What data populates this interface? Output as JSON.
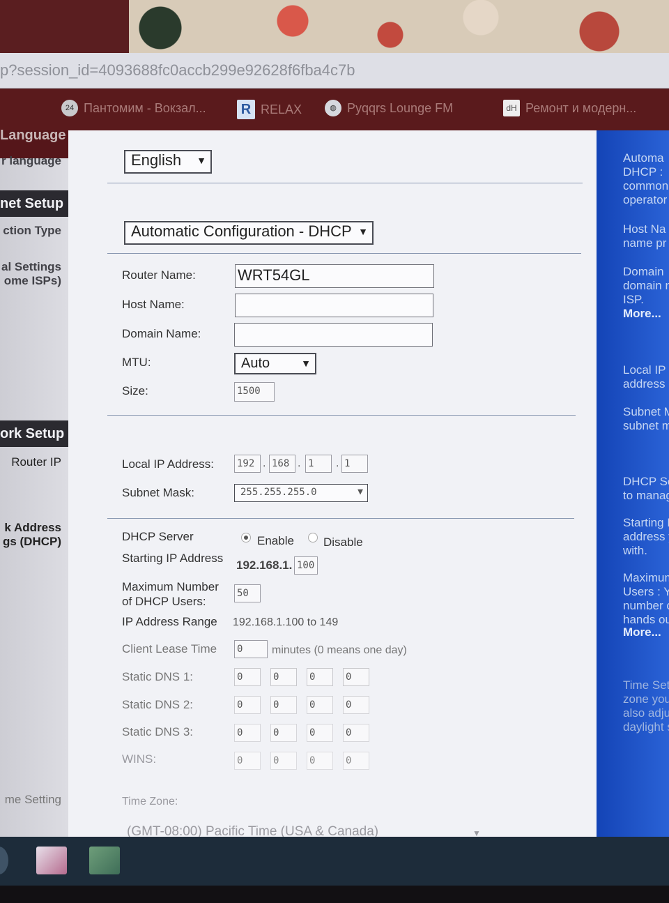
{
  "browser": {
    "url_fragment": "p?session_id=4093688fc0accb299e92628f6fba4c7b",
    "bookmarks": [
      {
        "icon": "badge-24-icon",
        "badge": "24",
        "label": "Пантомим - Вокзал..."
      },
      {
        "icon": "r-icon",
        "badge": "R",
        "label": "RELAX"
      },
      {
        "icon": "globe-icon",
        "badge": "",
        "label": "Pyqqrs Lounge FM"
      },
      {
        "icon": "dh-icon",
        "badge": "dH",
        "label": "Ремонт и модерн..."
      }
    ]
  },
  "leftnav": {
    "language_head": "Language",
    "language_item": "r language",
    "internet_head": "net Setup",
    "connection_type": "ction Type",
    "optional_settings": [
      "al Settings",
      "ome ISPs)"
    ],
    "network_head": "ork Setup",
    "router_ip": "Router IP",
    "address_settings": [
      "k Address",
      "gs (DHCP)"
    ],
    "time_setting": "me Setting"
  },
  "main": {
    "language_value": "English",
    "connection_value": "Automatic Configuration - DHCP",
    "router_name_label": "Router Name:",
    "router_name_value": "WRT54GL",
    "host_name_label": "Host Name:",
    "host_name_value": "",
    "domain_name_label": "Domain Name:",
    "domain_name_value": "",
    "mtu_label": "MTU:",
    "mtu_value": "Auto",
    "size_label": "Size:",
    "size_value": "1500",
    "local_ip_label": "Local IP Address:",
    "local_ip": [
      "192",
      "168",
      "1",
      "1"
    ],
    "subnet_label": "Subnet Mask:",
    "subnet_value": "255.255.255.0",
    "dhcp_server_label": "DHCP Server",
    "enable_label": "Enable",
    "disable_label": "Disable",
    "starting_ip_label": "Starting IP Address",
    "starting_ip_prefix": "192.168.1.",
    "starting_ip_last": "100",
    "max_users_label": "Maximum Number of  DHCP Users:",
    "max_users_value": "50",
    "ip_range_label": "IP Address Range",
    "ip_range_value": "192.168.1.100 to 149",
    "lease_label": "Client Lease Time",
    "lease_value": "0",
    "lease_suffix": "minutes (0 means one day)",
    "dns1_label": "Static DNS 1:",
    "dns2_label": "Static DNS 2:",
    "dns3_label": "Static DNS 3:",
    "wins_label": "WINS:",
    "dns_values": [
      "0",
      "0",
      "0",
      "0"
    ],
    "time_zone_label": "Time Zone:",
    "time_zone_value": "(GMT-08:00) Pacific Time (USA & Canada)"
  },
  "help": {
    "auto_dhcp": "Automa\nDHCP :\ncommon\noperator",
    "host_name": "Host Na\nname pr",
    "domain_name": "Domain\ndomain n\nISP.",
    "more1": "More...",
    "local_ip": "Local IP\naddress o",
    "subnet": "Subnet M\nsubnet m",
    "dhcp_server": "DHCP Se\nto manag",
    "starting": "Starting I\naddress y\nwith.",
    "max_users": "Maximum\nUsers : Yo\nnumber of\nhands out",
    "more2": "More...",
    "time_setting": "Time Setti\nzone you a\nalso adjust\ndaylight sa"
  }
}
